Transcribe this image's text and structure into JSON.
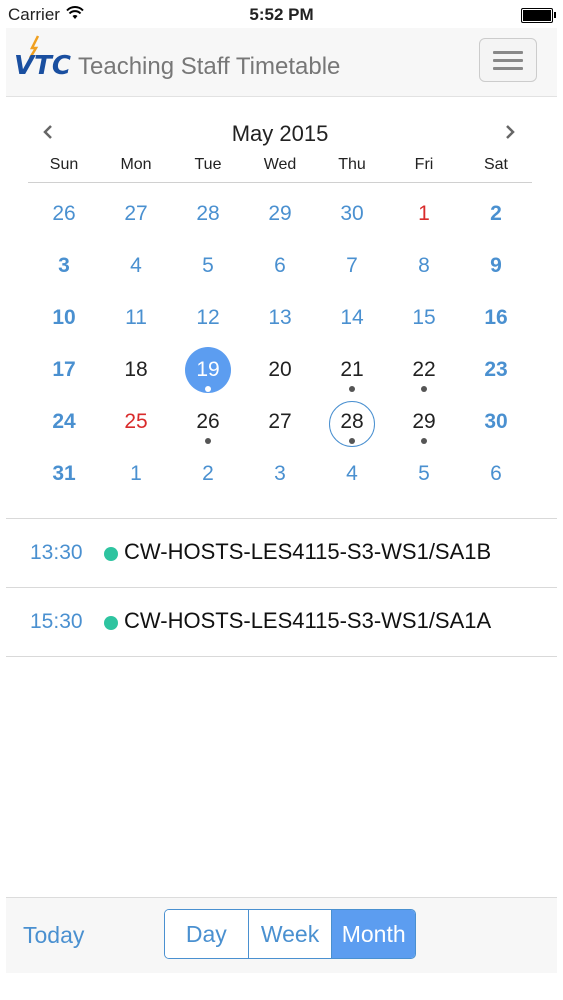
{
  "status_bar": {
    "carrier": "Carrier",
    "time": "5:52 PM"
  },
  "navbar": {
    "title": "Teaching Staff Timetable",
    "logo_text": "VTC"
  },
  "calendar": {
    "month_title": "May 2015",
    "weekdays": [
      "Sun",
      "Mon",
      "Tue",
      "Wed",
      "Thu",
      "Fri",
      "Sat"
    ],
    "weeks": [
      [
        {
          "n": "26",
          "t": "other"
        },
        {
          "n": "27",
          "t": "other"
        },
        {
          "n": "28",
          "t": "other"
        },
        {
          "n": "29",
          "t": "other"
        },
        {
          "n": "30",
          "t": "other"
        },
        {
          "n": "1",
          "t": "holiday"
        },
        {
          "n": "2",
          "t": "weekend"
        }
      ],
      [
        {
          "n": "3",
          "t": "weekend"
        },
        {
          "n": "4",
          "t": "other"
        },
        {
          "n": "5",
          "t": "other"
        },
        {
          "n": "6",
          "t": "other"
        },
        {
          "n": "7",
          "t": "other"
        },
        {
          "n": "8",
          "t": "other"
        },
        {
          "n": "9",
          "t": "weekend"
        }
      ],
      [
        {
          "n": "10",
          "t": "weekend"
        },
        {
          "n": "11",
          "t": "other"
        },
        {
          "n": "12",
          "t": "other"
        },
        {
          "n": "13",
          "t": "other"
        },
        {
          "n": "14",
          "t": "other"
        },
        {
          "n": "15",
          "t": "other"
        },
        {
          "n": "16",
          "t": "weekend"
        }
      ],
      [
        {
          "n": "17",
          "t": "weekend"
        },
        {
          "n": "18",
          "t": "normal"
        },
        {
          "n": "19",
          "t": "normal",
          "selected": true,
          "dot": true
        },
        {
          "n": "20",
          "t": "normal"
        },
        {
          "n": "21",
          "t": "normal",
          "dot": true
        },
        {
          "n": "22",
          "t": "normal",
          "dot": true
        },
        {
          "n": "23",
          "t": "weekend"
        }
      ],
      [
        {
          "n": "24",
          "t": "weekend"
        },
        {
          "n": "25",
          "t": "holiday"
        },
        {
          "n": "26",
          "t": "normal",
          "dot": true
        },
        {
          "n": "27",
          "t": "normal"
        },
        {
          "n": "28",
          "t": "normal",
          "today": true,
          "dot": true
        },
        {
          "n": "29",
          "t": "normal",
          "dot": true
        },
        {
          "n": "30",
          "t": "weekend"
        }
      ],
      [
        {
          "n": "31",
          "t": "weekend"
        },
        {
          "n": "1",
          "t": "other"
        },
        {
          "n": "2",
          "t": "other"
        },
        {
          "n": "3",
          "t": "other"
        },
        {
          "n": "4",
          "t": "other"
        },
        {
          "n": "5",
          "t": "other"
        },
        {
          "n": "6",
          "t": "other"
        }
      ]
    ]
  },
  "events": [
    {
      "time": "13:30",
      "name": "CW-HOSTS-LES4115-S3-WS1/SA1B"
    },
    {
      "time": "15:30",
      "name": "CW-HOSTS-LES4115-S3-WS1/SA1A"
    }
  ],
  "toolbar": {
    "today_label": "Today",
    "views": [
      "Day",
      "Week",
      "Month"
    ],
    "active_view": "Month"
  },
  "colors": {
    "accent": "#4a90d0",
    "selected": "#5c9df0",
    "holiday": "#d92b2b",
    "event_dot": "#2ec4a0"
  }
}
